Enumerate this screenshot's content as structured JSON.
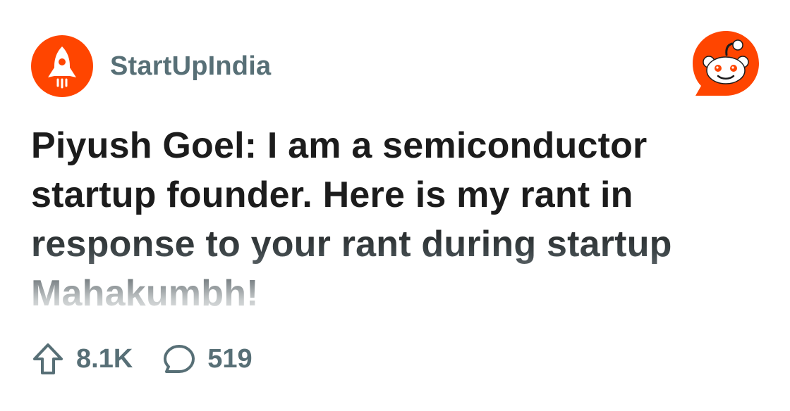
{
  "post": {
    "subreddit": "StartUpIndia",
    "title": "Piyush Goel: I am a semiconductor startup founder. Here is my rant in response to your rant during startup Mahakumbh!",
    "upvotes": "8.1K",
    "comments": "519"
  },
  "icons": {
    "subreddit_avatar": "rocket-icon",
    "brand_logo": "reddit-snoo-icon",
    "upvote": "upvote-arrow-icon",
    "comments": "comment-bubble-icon"
  },
  "colors": {
    "brand": "#ff4500",
    "muted_text": "#576f76",
    "title_text": "#1c1c1c",
    "background": "#ffffff"
  }
}
